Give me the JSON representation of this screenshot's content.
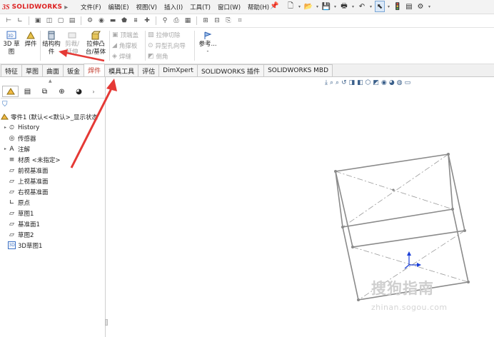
{
  "app": {
    "logo_mark": "3S",
    "logo_text": "SOLIDWORKS",
    "logo_arrow": "▸"
  },
  "menu": [
    "文件(F)",
    "编辑(E)",
    "视图(V)",
    "插入(I)",
    "工具(T)",
    "窗口(W)",
    "帮助(H)"
  ],
  "ribbon": {
    "sketch3d_label": "3D 草\n图",
    "weldment_label": "焊件",
    "structural_member_label": "结构构\n件",
    "trim_extend_label": "剪裁/\n延伸",
    "extrude_boss_label": "拉伸凸\n台/基体",
    "end_cap_label": "顶端盖",
    "gusset_label": "角撑板",
    "weld_bead_label": "焊缝",
    "extruded_cut_label": "拉伸切除",
    "hole_wizard_label": "异型孔向导",
    "chamfer_label": "倒角",
    "reference_label": "参考...",
    "reference_dot": "-"
  },
  "tabs": [
    "特征",
    "草图",
    "曲面",
    "钣金",
    "焊件",
    "模具工具",
    "评估",
    "DimXpert",
    "SOLIDWORKS 插件",
    "SOLIDWORKS MBD"
  ],
  "active_tab": "焊件",
  "feature_tree": {
    "root_label": "零件1 (默认<<默认>_显示状态",
    "items": [
      {
        "label": "History",
        "icon": "history-icon",
        "expandable": true
      },
      {
        "label": "传感器",
        "icon": "sensor-icon",
        "expandable": false
      },
      {
        "label": "注解",
        "icon": "annotation-icon",
        "expandable": true
      },
      {
        "label": "材质 <未指定>",
        "icon": "material-icon",
        "expandable": false
      },
      {
        "label": "前视基准面",
        "icon": "plane-icon",
        "expandable": false
      },
      {
        "label": "上视基准面",
        "icon": "plane-icon",
        "expandable": false
      },
      {
        "label": "右视基准面",
        "icon": "plane-icon",
        "expandable": false
      },
      {
        "label": "原点",
        "icon": "origin-icon",
        "expandable": false
      },
      {
        "label": "草图1",
        "icon": "sketch-icon",
        "expandable": false
      },
      {
        "label": "基准面1",
        "icon": "plane-icon",
        "expandable": false
      },
      {
        "label": "草图2",
        "icon": "sketch-icon",
        "expandable": false
      },
      {
        "label": "3D草图1",
        "icon": "sketch3d-icon",
        "expandable": false
      }
    ]
  },
  "watermark": {
    "brand": "搜狗指南",
    "url": "zhinan.sogou.com"
  },
  "colors": {
    "accent_red": "#e53935",
    "sketch_gray": "#8a8a8a",
    "axis_blue": "#1a3fd8",
    "active_tab_text": "#c0392b"
  }
}
